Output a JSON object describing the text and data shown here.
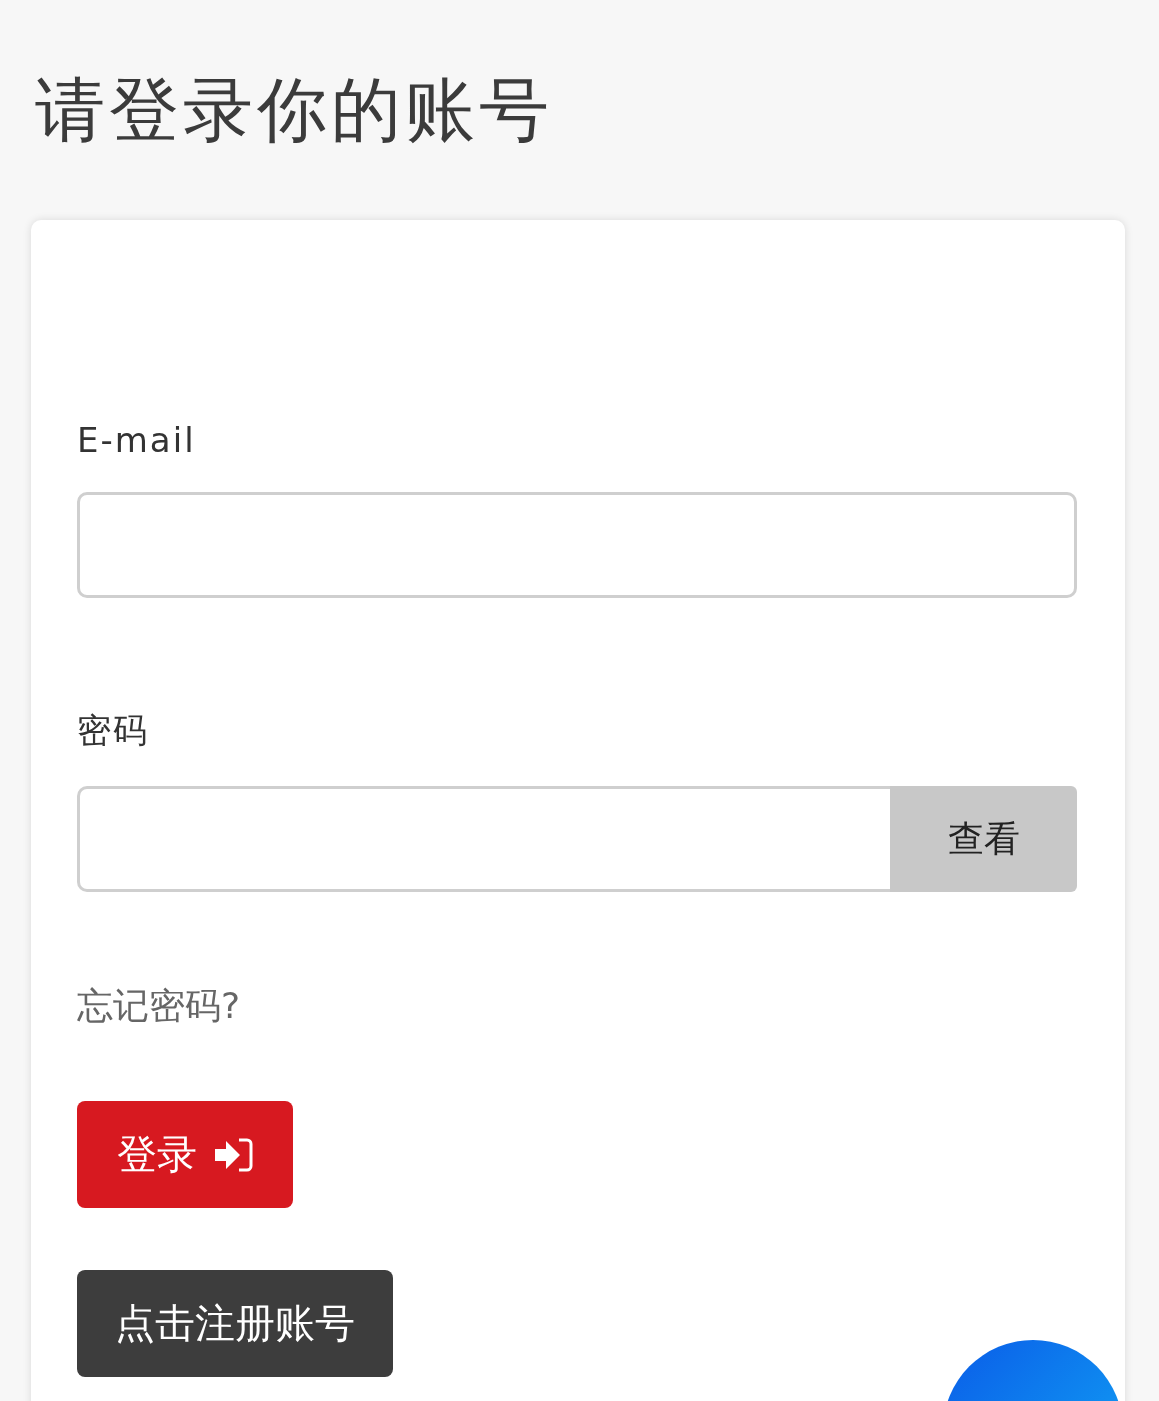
{
  "title": "请登录你的账号",
  "email": {
    "label": "E-mail"
  },
  "password": {
    "label": "密码",
    "reveal_button": "查看"
  },
  "forgot_link": "忘记密码?",
  "login_button": "登录",
  "register_button": "点击注册账号"
}
